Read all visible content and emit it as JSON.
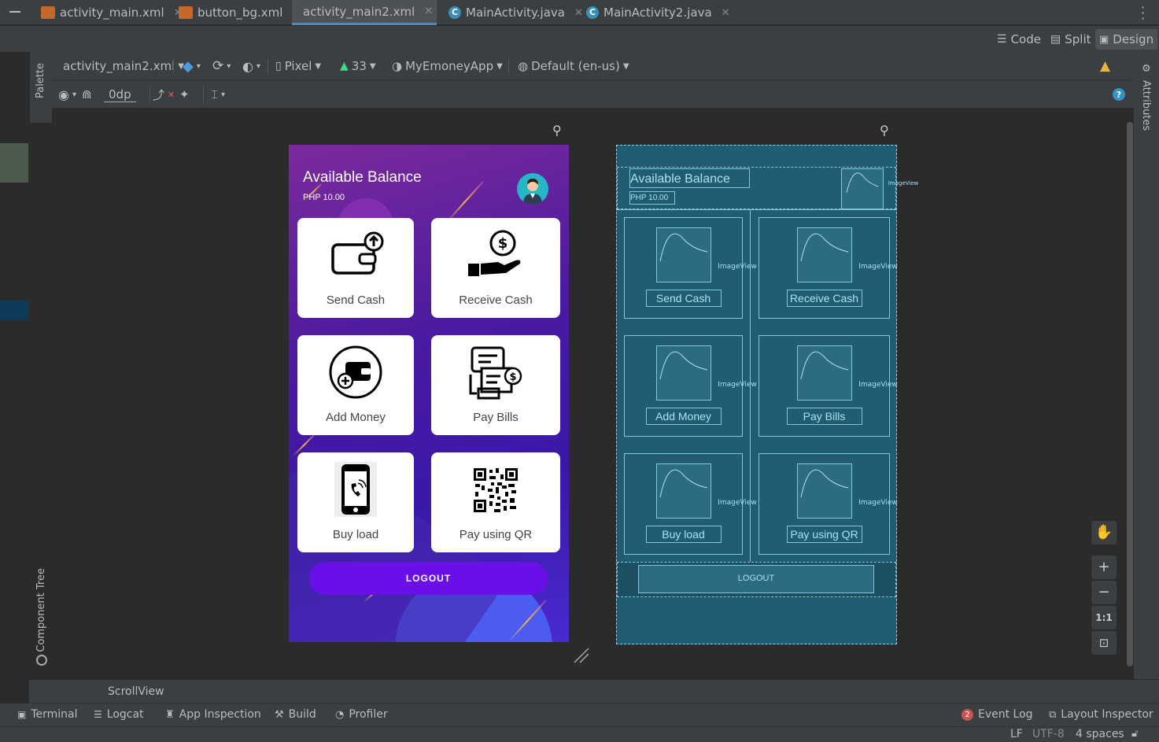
{
  "tabs": [
    {
      "label": "activity_main.xml",
      "type": "xml"
    },
    {
      "label": "button_bg.xml",
      "type": "xml"
    },
    {
      "label": "activity_main2.xml",
      "type": "xml",
      "active": true
    },
    {
      "label": "MainActivity.java",
      "type": "java"
    },
    {
      "label": "MainActivity2.java",
      "type": "java"
    }
  ],
  "view_modes": {
    "code": "Code",
    "split": "Split",
    "design": "Design",
    "selected": "Design"
  },
  "side_panels": {
    "palette": "Palette",
    "attributes": "Attributes",
    "component_tree": "Component Tree"
  },
  "toolbar": {
    "file": "activity_main2.xml",
    "device": "Pixel",
    "api": "33",
    "theme": "MyEmoneyApp",
    "locale": "Default (en-us)",
    "margin": "0dp"
  },
  "app": {
    "balance_title": "Available Balance",
    "balance_amount": "PHP 10.00",
    "cards": [
      {
        "label": "Send Cash",
        "icon": "wallet-send-icon"
      },
      {
        "label": "Receive Cash",
        "icon": "receive-cash-icon"
      },
      {
        "label": "Add Money",
        "icon": "add-money-icon"
      },
      {
        "label": "Pay Bills",
        "icon": "pay-bills-icon"
      },
      {
        "label": "Buy load",
        "icon": "buy-load-phone-icon"
      },
      {
        "label": "Pay using QR",
        "icon": "qr-code-icon"
      }
    ],
    "logout": "LOGOUT",
    "colors": {
      "gradient_top": "#7b2a9b",
      "gradient_bottom": "#3a18a8",
      "button": "#6b0fe8",
      "card": "#ffffff"
    }
  },
  "blueprint": {
    "image_view_label": "ImageView",
    "blueprint_bg": "#215c72"
  },
  "breadcrumb": "ScrollView",
  "zoom": {
    "pan": "pan-hand-icon",
    "zoom_in": "+",
    "zoom_out": "−",
    "actual": "1:1",
    "fit": "fit-screen-icon"
  },
  "tool_windows": [
    {
      "label": "Terminal"
    },
    {
      "label": "Logcat"
    },
    {
      "label": "App Inspection"
    },
    {
      "label": "Build"
    },
    {
      "label": "Profiler"
    }
  ],
  "event_log": {
    "label": "Event Log",
    "count": "2"
  },
  "layout_inspector": "Layout Inspector",
  "status": {
    "line_sep": "LF",
    "encoding": "UTF-8",
    "indent": "4 spaces"
  }
}
